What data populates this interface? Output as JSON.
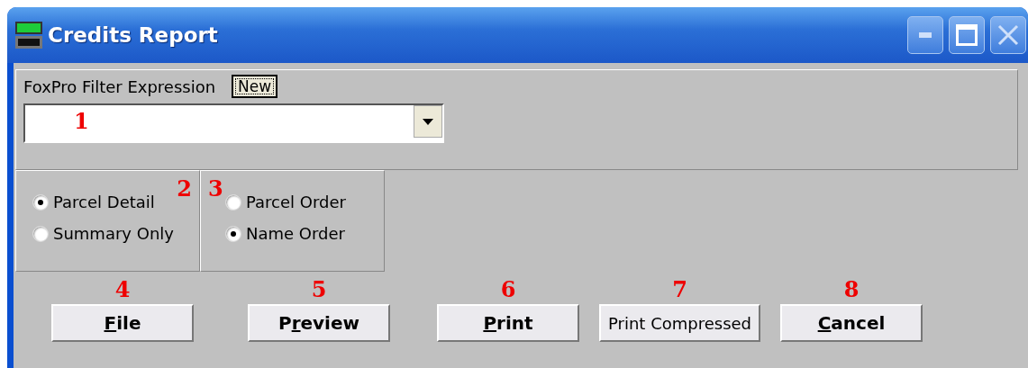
{
  "window": {
    "title": "Credits Report"
  },
  "filter": {
    "label": "FoxPro Filter Expression",
    "new_button": "New",
    "callout": "1"
  },
  "option_groups": [
    {
      "callout": "2",
      "options": [
        {
          "label": "Parcel Detail",
          "selected": true
        },
        {
          "label": "Summary Only",
          "selected": false
        }
      ]
    },
    {
      "callout": "3",
      "options": [
        {
          "label": "Parcel Order",
          "selected": false
        },
        {
          "label": "Name Order",
          "selected": true
        }
      ]
    }
  ],
  "buttons": [
    {
      "kind": "mnemonic",
      "key": "F",
      "after": "ile",
      "callout": "4"
    },
    {
      "kind": "mnemonic",
      "before": "P",
      "key": "r",
      "after": "eview",
      "callout": "5"
    },
    {
      "kind": "mnemonic",
      "key": "P",
      "after": "rint",
      "callout": "6"
    },
    {
      "kind": "plain",
      "label": "Print Compressed",
      "callout": "7"
    },
    {
      "kind": "mnemonic",
      "key": "C",
      "after": "ancel",
      "callout": "8"
    }
  ]
}
